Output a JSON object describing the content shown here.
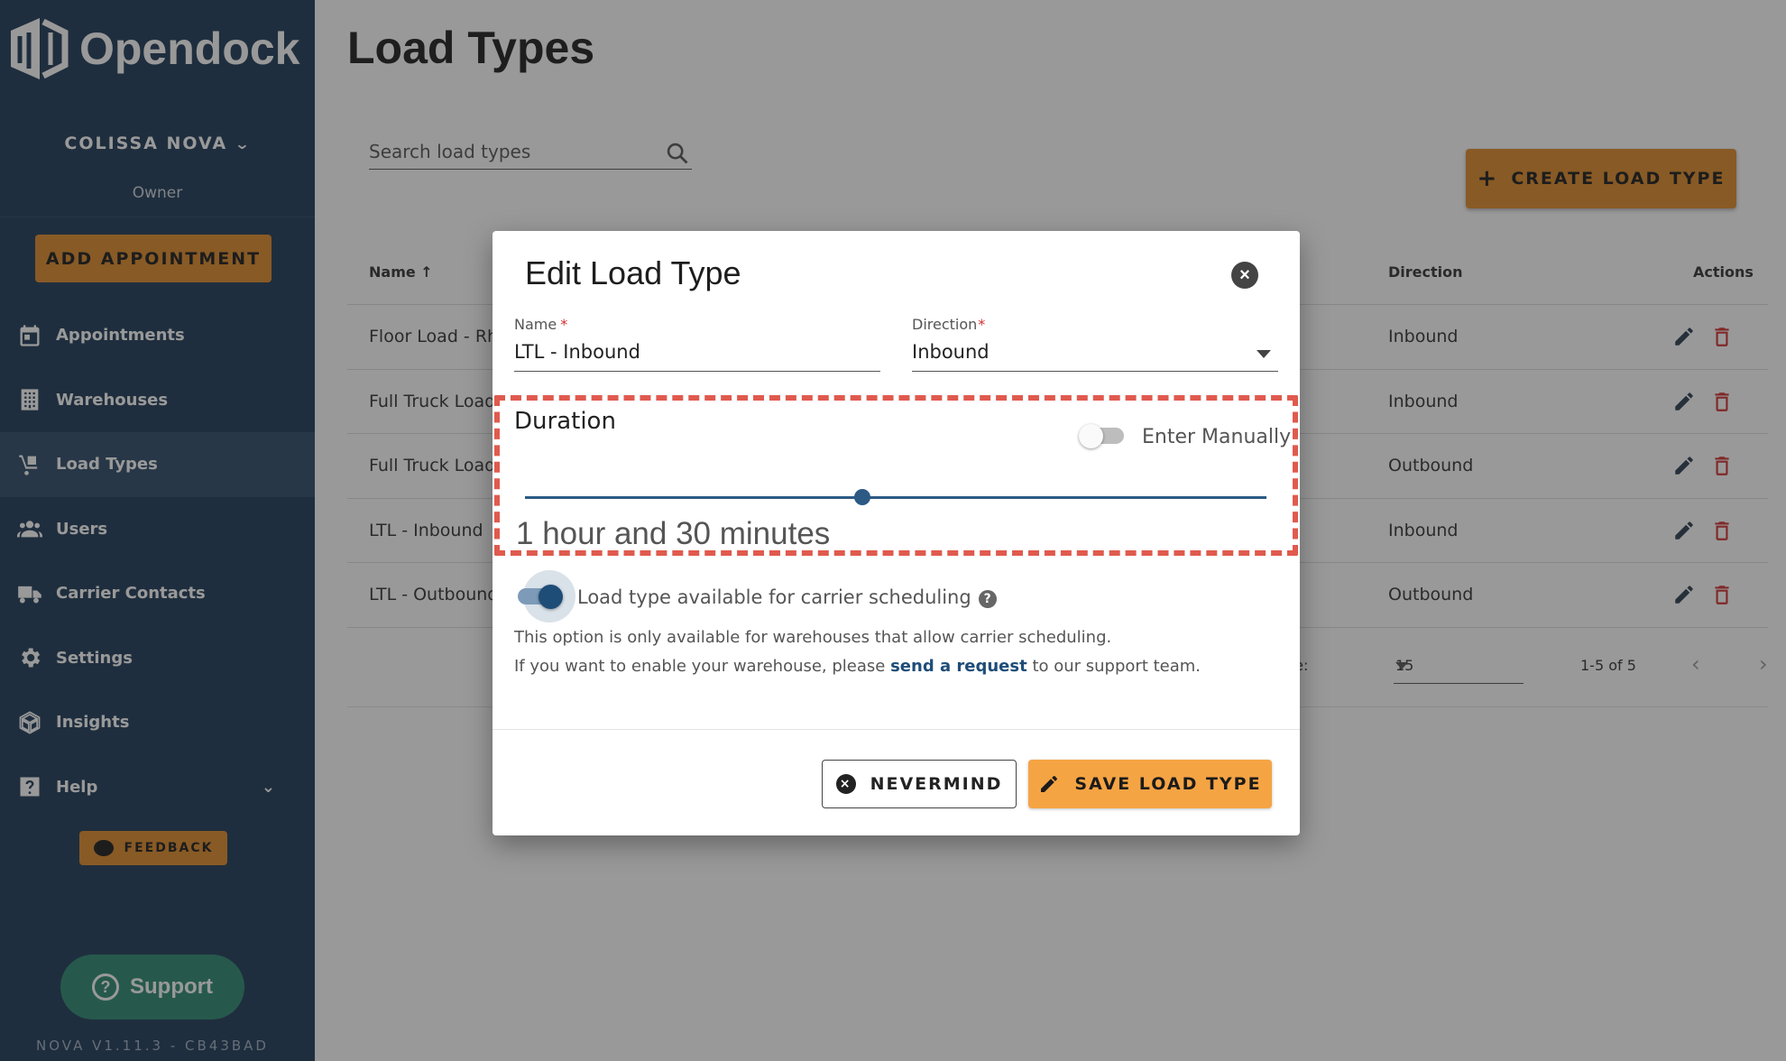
{
  "sidebar": {
    "brand": "Opendock",
    "org_name": "COLISSA NOVA",
    "role": "Owner",
    "add_appointment": "ADD APPOINTMENT",
    "items": [
      {
        "label": "Appointments",
        "icon": "calendar-icon"
      },
      {
        "label": "Warehouses",
        "icon": "building-icon"
      },
      {
        "label": "Load Types",
        "icon": "hand-truck-icon",
        "active": true
      },
      {
        "label": "Users",
        "icon": "users-icon"
      },
      {
        "label": "Carrier Contacts",
        "icon": "truck-icon"
      },
      {
        "label": "Settings",
        "icon": "gear-icon"
      },
      {
        "label": "Insights",
        "icon": "insights-icon"
      },
      {
        "label": "Help",
        "icon": "help-icon"
      }
    ],
    "feedback": "FEEDBACK",
    "support": "Support",
    "version": "NOVA V1.11.3 - CB43BAD"
  },
  "page": {
    "title": "Load Types",
    "search_placeholder": "Search load types",
    "create_button": "CREATE LOAD TYPE",
    "table": {
      "headers": {
        "name": "Name",
        "direction": "Direction",
        "actions": "Actions"
      },
      "rows": [
        {
          "name": "Floor Load - Rh",
          "direction": "Inbound"
        },
        {
          "name": "Full Truck Load",
          "direction": "Inbound"
        },
        {
          "name": "Full Truck Load",
          "direction": "Outbound"
        },
        {
          "name": "LTL - Inbound",
          "direction": "Inbound"
        },
        {
          "name": "LTL - Outbound",
          "direction": "Outbound"
        }
      ],
      "per_page_label": "ge:",
      "per_page_value": "15",
      "range": "1-5 of 5"
    }
  },
  "dialog": {
    "title": "Edit Load Type",
    "name_label": "Name",
    "name_value": "LTL - Inbound",
    "direction_label": "Direction",
    "direction_value": "Inbound",
    "duration_label": "Duration",
    "enter_manually_label": "Enter Manually",
    "enter_manually_on": false,
    "duration_fraction": 0.455,
    "duration_text": "1 hour and 30 minutes",
    "carrier_label": "Load type available for carrier scheduling",
    "carrier_on": true,
    "note_line1": "This option is only available for warehouses that allow carrier scheduling.",
    "note_line2_pre": "If you want to enable your warehouse, please ",
    "note_link": "send a request",
    "note_line2_post": " to our support team.",
    "cancel_button": "NEVERMIND",
    "save_button": "SAVE LOAD TYPE"
  },
  "colors": {
    "sidebar_bg": "#1e3a57",
    "accent_orange": "#e08b2a",
    "primary_blue": "#2c5a85",
    "highlight_dash": "#e05a4e"
  }
}
